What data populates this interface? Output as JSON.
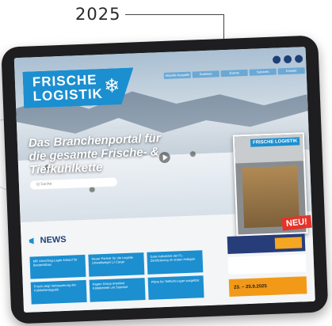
{
  "year_label": "2025",
  "brand": {
    "line1": "FRISCHE",
    "line2": "LOGISTIK",
    "snow_icon": "snowflake-icon"
  },
  "nav_items": [
    "Aktuelle Ausgabe",
    "Rubriken",
    "Events",
    "Services",
    "Kontakt"
  ],
  "hero": {
    "title": "Das Branchenportal für die gesamte Frische- & Tiefkühlkette",
    "search_placeholder": "Q Suche"
  },
  "magazine": {
    "logo": "FRISCHE LOGISTIK",
    "badge": "NEU!"
  },
  "news": {
    "heading": "NEWS",
    "items": [
      "MR Umschlag-Lager Ankauf für Bestandsbau",
      "Neuer Partner für die Logistik-Umweltsiegel LJ Cargo",
      "Gute Aufnahme der FL-Zertifizierung im ersten Halbjahr",
      "Frisch zeigt Verbesserung der Kühlkettenlogistik",
      "Ragen Group erweitert Kältebetrieb um Standort",
      "Pläne für Tiefkühl-Lager ausgelöst"
    ]
  },
  "sidebar": {
    "event_date": "23. – 25.9.2025"
  },
  "colors": {
    "accent": "#1b8fd0",
    "navy": "#1d3f77",
    "orange": "#f29a18",
    "red": "#e5332a"
  }
}
